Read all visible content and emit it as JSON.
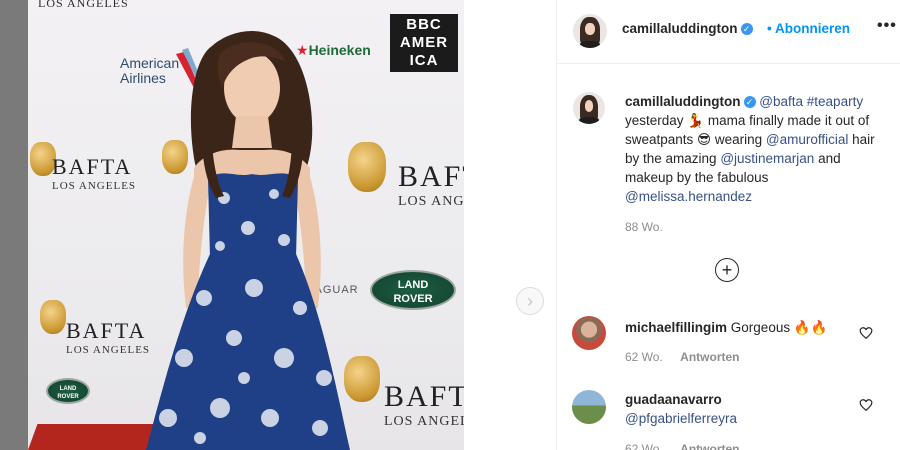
{
  "post": {
    "username": "camillaluddington",
    "follow_label": "Abonnieren",
    "more_label": "•••",
    "verified_mark": "✓",
    "caption_parts": {
      "mention_bafta": "@bafta",
      "hashtag": "#teaparty",
      "text_1": " yesterday ",
      "emoji_1": "💃",
      "text_2": " mama finally made it out of sweatpants ",
      "emoji_2": "😎",
      "text_3": " wearing ",
      "mention_hair": "@amurofficial",
      "text_4": " hair by the amazing ",
      "mention_justine": "@justinemarjan",
      "text_5": " and makeup by the fabulous ",
      "mention_melissa": "@melissa.hernandez"
    },
    "caption_time": "88 Wo.",
    "add_comment_icon": "+"
  },
  "comments": [
    {
      "username": "michaelfillingim",
      "text": "Gorgeous 🔥🔥",
      "time": "62 Wo.",
      "reply_label": "Antworten"
    },
    {
      "username": "guadaanavarro",
      "text": "@pfgabrielferreyra",
      "time": "62 Wo.",
      "reply_label": "Antworten"
    }
  ],
  "photo": {
    "bafta_word": "BAFTA",
    "bafta_sub": "LOS ANGELES",
    "bbc_lines": [
      "BBC",
      "AMER",
      "ICA"
    ],
    "american_airlines": [
      "American",
      "Airlines"
    ],
    "heineken": "Heineken",
    "landrover": [
      "LAND",
      "ROVER"
    ],
    "jaguar": "JAGUAR",
    "top_text": "LOS ANGELES"
  },
  "nav": {
    "next_icon": "›"
  },
  "colors": {
    "accent": "#0095f6",
    "verified": "#3897f0",
    "dress": "#1f3f86"
  }
}
